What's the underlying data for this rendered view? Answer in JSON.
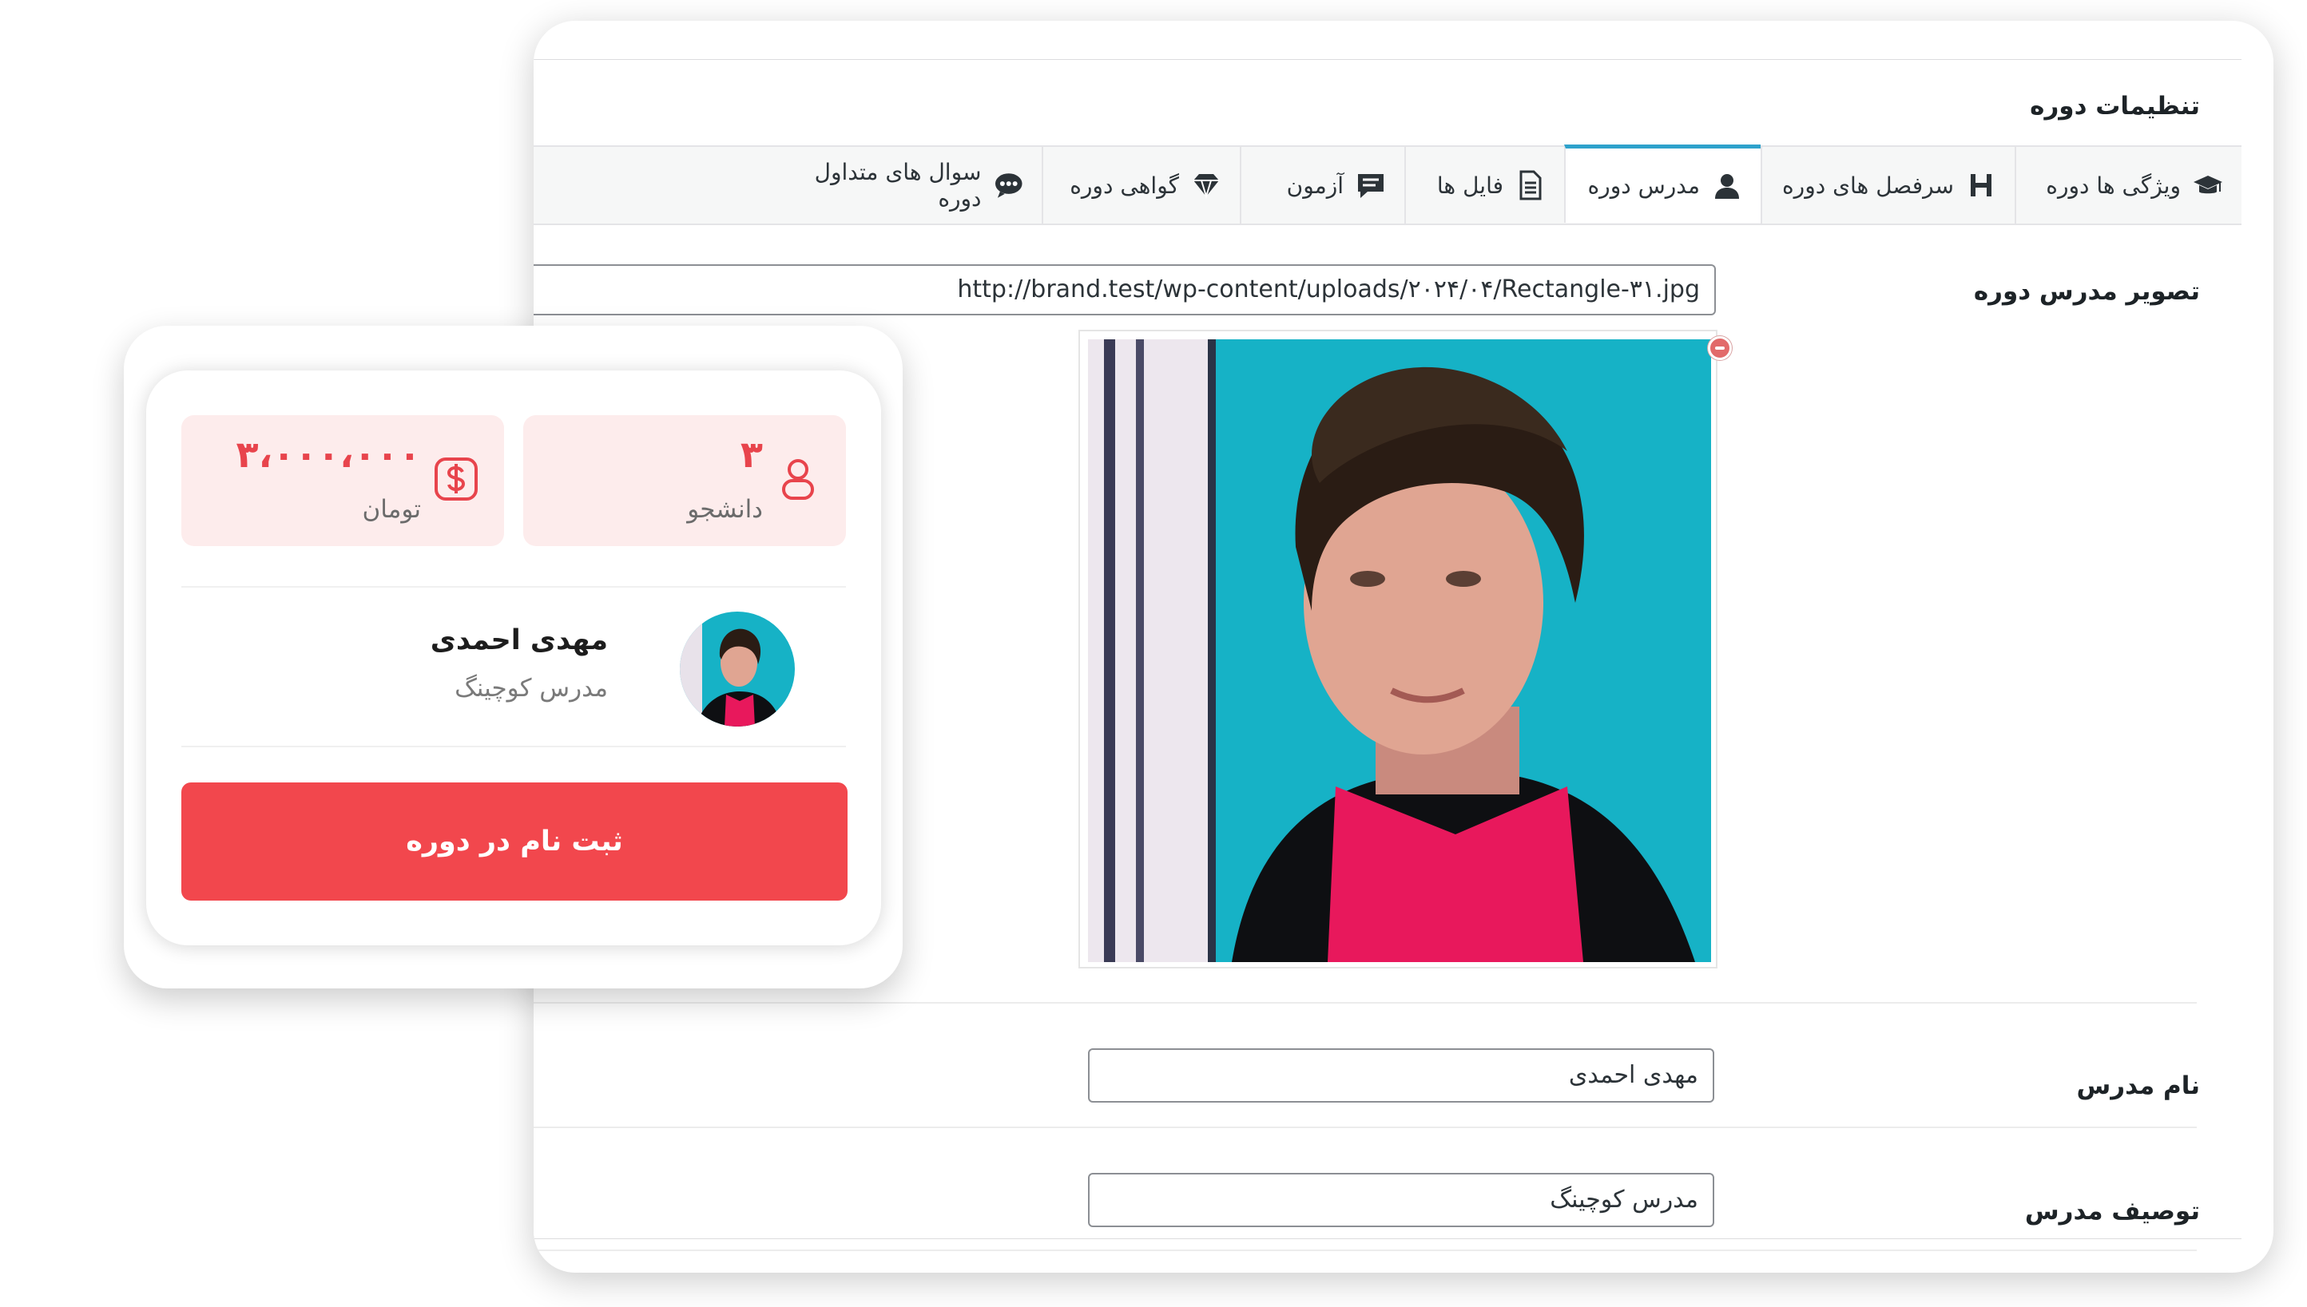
{
  "panel": {
    "title": "تنظیمات دوره",
    "tabs": [
      {
        "label": "ویژگی ها دوره",
        "icon": "graduation-cap-icon"
      },
      {
        "label": "سرفصل های دوره",
        "icon": "heading-icon"
      },
      {
        "label": "مدرس دوره",
        "icon": "user-icon",
        "active": true
      },
      {
        "label": "فایل ها",
        "icon": "document-icon"
      },
      {
        "label": "آزمون",
        "icon": "comment-icon"
      },
      {
        "label": "گواهی دوره",
        "icon": "diamond-icon"
      },
      {
        "label": "سوال های متداول دوره",
        "icon": "chat-bubbles-icon"
      }
    ],
    "image_label": "تصویر مدرس دوره",
    "image_url": "http://brand.test/wp-content/uploads/۲۰۲۴/۰۴/Rectangle-۳۱.jpg",
    "name_label": "نام مدرس",
    "name_value": "مهدی احمدی",
    "desc_label": "توصیف مدرس",
    "desc_value": "مدرس کوچینگ"
  },
  "card": {
    "students_count": "۳",
    "students_label": "دانشجو",
    "price": "۳،۰۰۰،۰۰۰",
    "currency": "تومان",
    "instructor_name": "مهدی احمدی",
    "instructor_role": "مدرس کوچینگ",
    "enroll_label": "ثبت نام در دوره"
  },
  "colors": {
    "accent": "#f2474d",
    "tab_active": "#2ea2cc",
    "stat_bg": "#fdecec"
  }
}
